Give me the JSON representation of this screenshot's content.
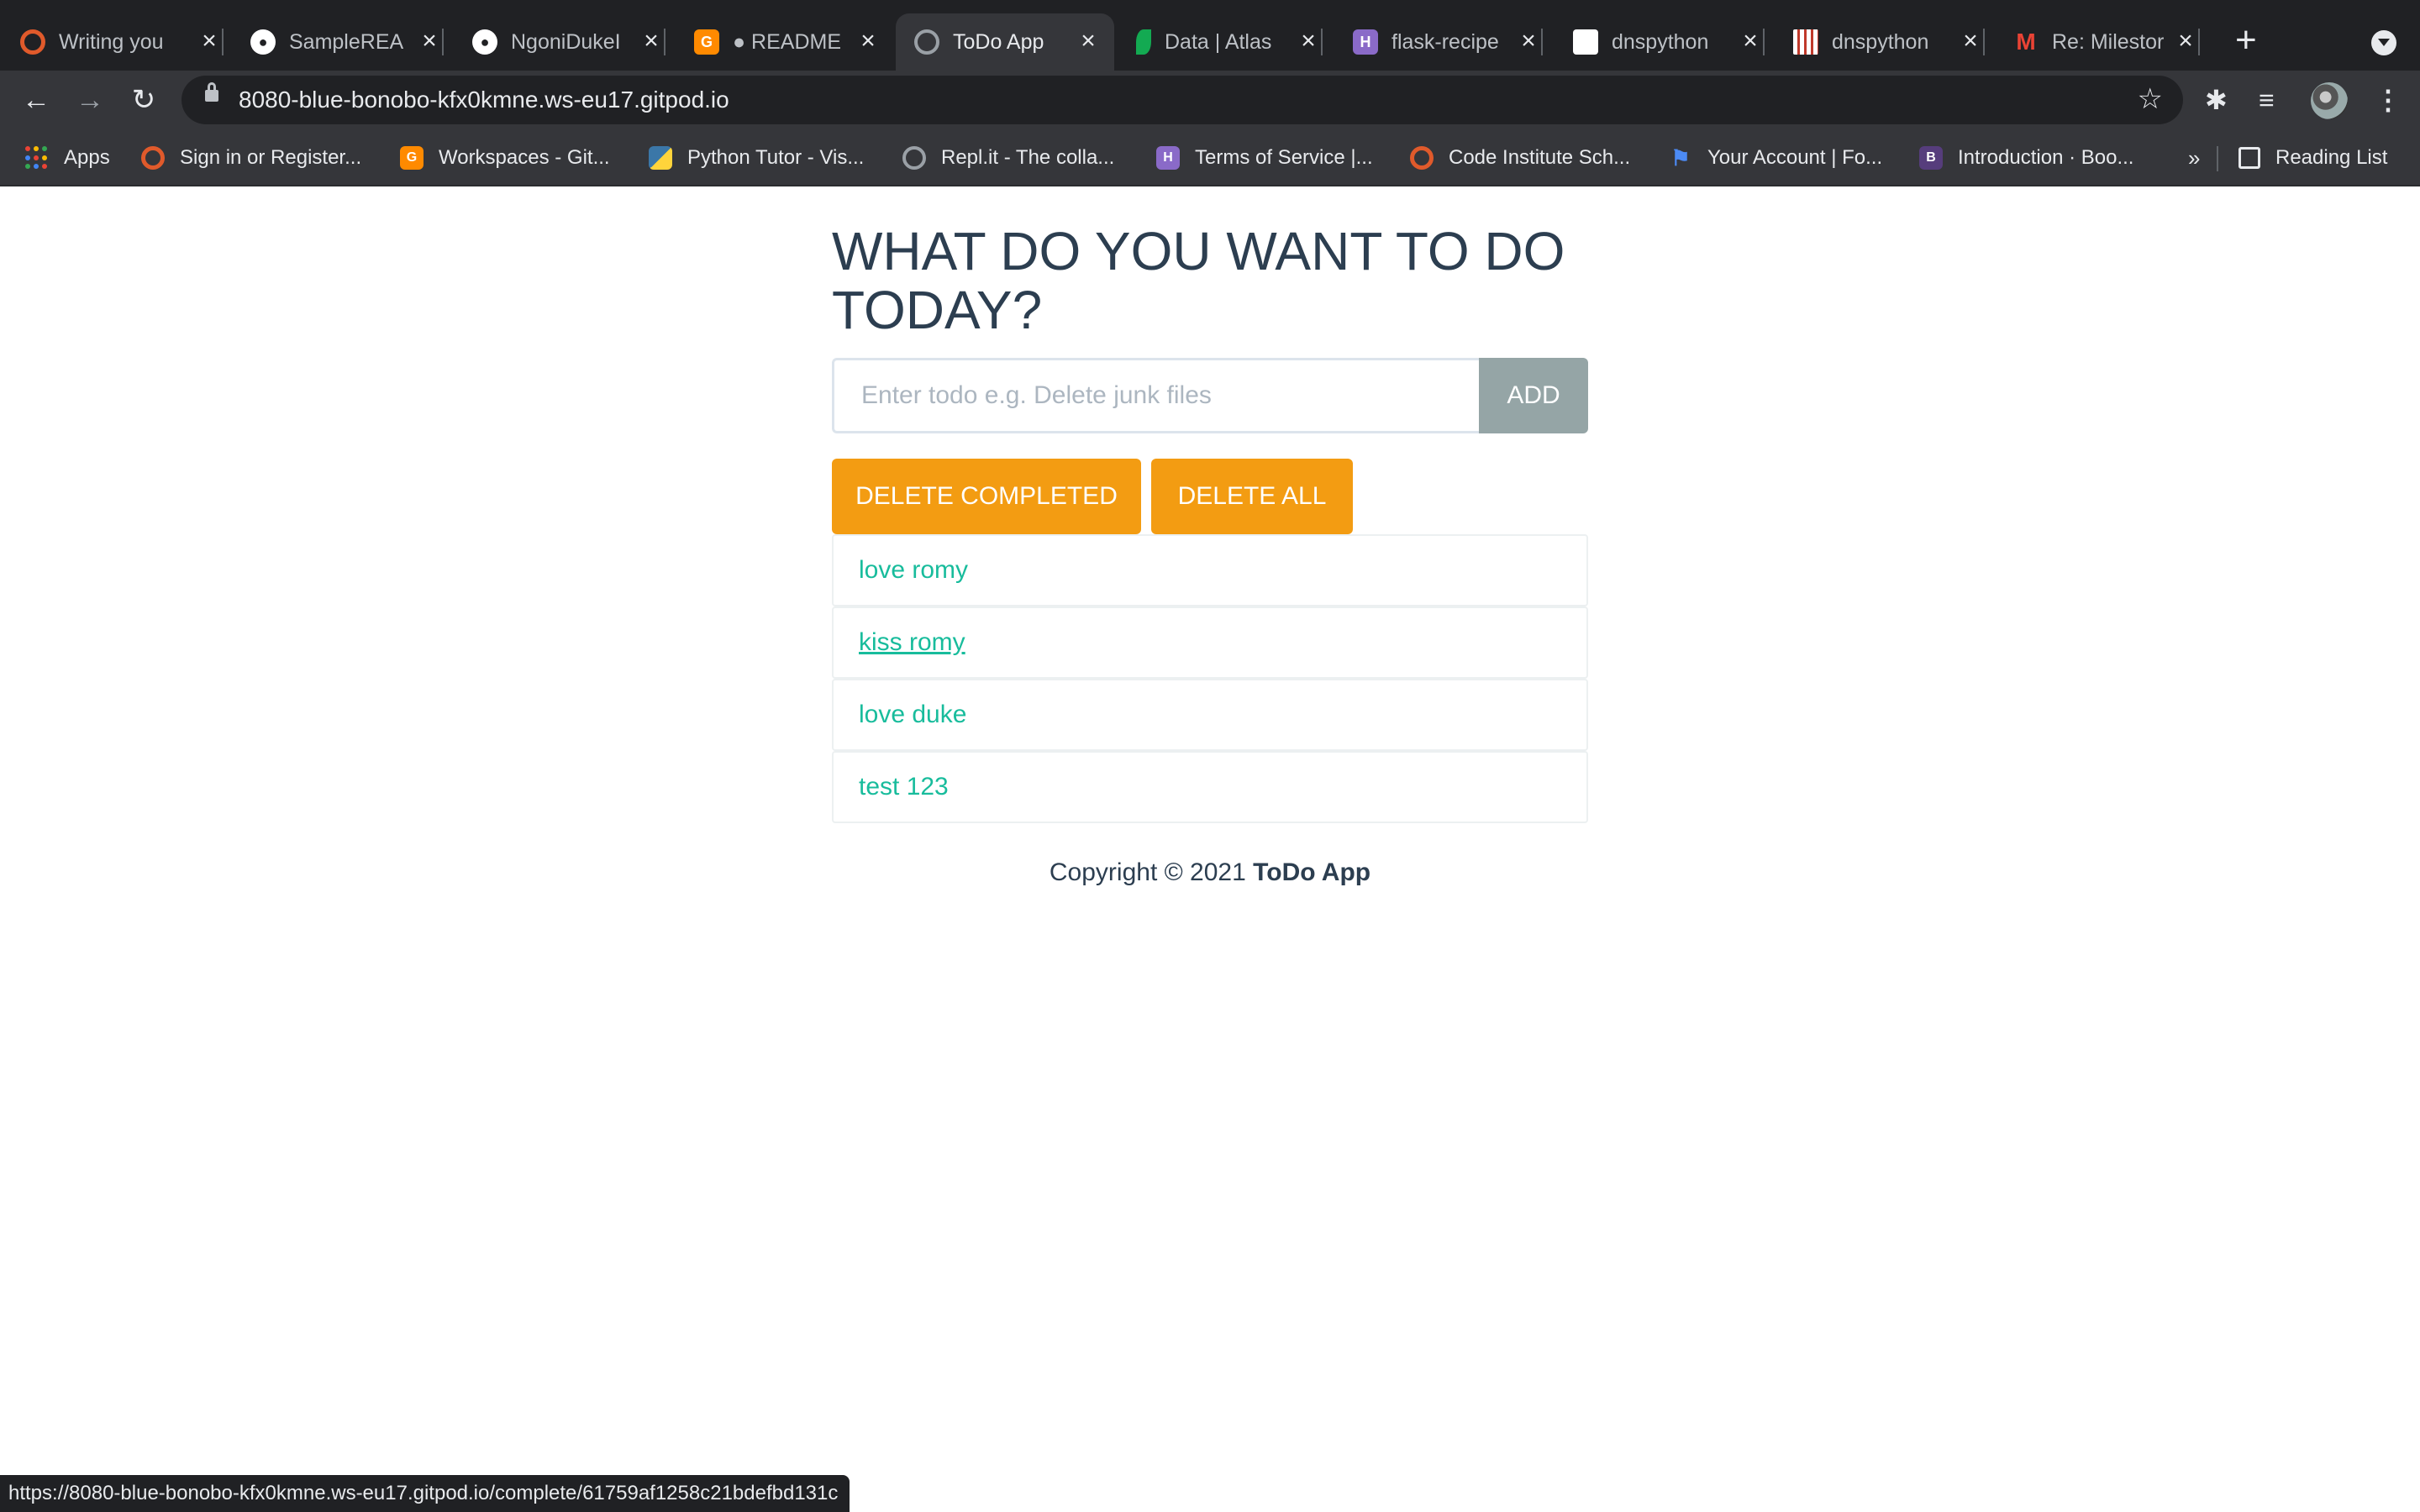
{
  "browser": {
    "tabs": [
      {
        "title": "Writing you",
        "icon": "codeinstitute-icon",
        "color": "#e05a2b"
      },
      {
        "title": "SampleREA",
        "icon": "github-icon",
        "color": "#ffffff"
      },
      {
        "title": "NgoniDukeI",
        "icon": "github-icon",
        "color": "#ffffff"
      },
      {
        "title": "● README",
        "icon": "gitpod-icon",
        "color": "#ff8a00"
      },
      {
        "title": "ToDo App",
        "icon": "globe-icon",
        "color": "#9aa0a6"
      },
      {
        "title": "Data | Atlas",
        "icon": "mongodb-leaf-icon",
        "color": "#13aa52"
      },
      {
        "title": "flask-recipe",
        "icon": "heroku-icon",
        "color": "#8a6ac8"
      },
      {
        "title": "dnspython",
        "icon": "cube-icon",
        "color": "#ffffff"
      },
      {
        "title": "dnspython",
        "icon": "pypi-icon",
        "color": "#ffffff"
      },
      {
        "title": "Re: Milestor",
        "icon": "gmail-icon",
        "color": "#ea4335"
      }
    ],
    "new_tab": "+",
    "url": "8080-blue-bonobo-kfx0kmne.ws-eu17.gitpod.io",
    "bookmarks": [
      {
        "label": "Apps",
        "icon": "apps-grid-icon"
      },
      {
        "label": "Sign in or Register...",
        "icon": "codeinstitute-icon",
        "color": "#e05a2b"
      },
      {
        "label": "Workspaces - Git...",
        "icon": "gitpod-icon",
        "color": "#ff8a00"
      },
      {
        "label": "Python Tutor - Vis...",
        "icon": "python-icon",
        "color": "#3b77a8"
      },
      {
        "label": "Repl.it - The colla...",
        "icon": "replit-icon",
        "color": "#9aa0a6"
      },
      {
        "label": "Terms of Service |...",
        "icon": "heroku-icon",
        "color": "#8a6ac8"
      },
      {
        "label": "Code Institute Sch...",
        "icon": "codeinstitute-icon",
        "color": "#e05a2b"
      },
      {
        "label": "Your Account | Fo...",
        "icon": "flag-icon",
        "color": "#4c8bf5"
      },
      {
        "label": "Introduction · Boo...",
        "icon": "bootstrap-icon",
        "color": "#563d7c"
      }
    ],
    "more_bookmarks": "»",
    "reading_list": "Reading List",
    "status_url": "https://8080-blue-bonobo-kfx0kmne.ws-eu17.gitpod.io/complete/61759af1258c21bdefbd131c"
  },
  "app": {
    "heading": "WHAT DO YOU WANT TO DO TODAY?",
    "input_placeholder": "Enter todo e.g. Delete junk files",
    "add_label": "ADD",
    "delete_completed_label": "DELETE COMPLETED",
    "delete_all_label": "DELETE ALL",
    "todos": [
      "love romy",
      "kiss romy",
      "love duke",
      "test 123"
    ],
    "footer_prefix": "Copyright © 2021 ",
    "footer_brand": "ToDo App"
  },
  "colors": {
    "heading": "#2c3e50",
    "todo_text": "#18bc9c",
    "warning_button": "#f39c12",
    "add_button": "#95a5a6"
  }
}
